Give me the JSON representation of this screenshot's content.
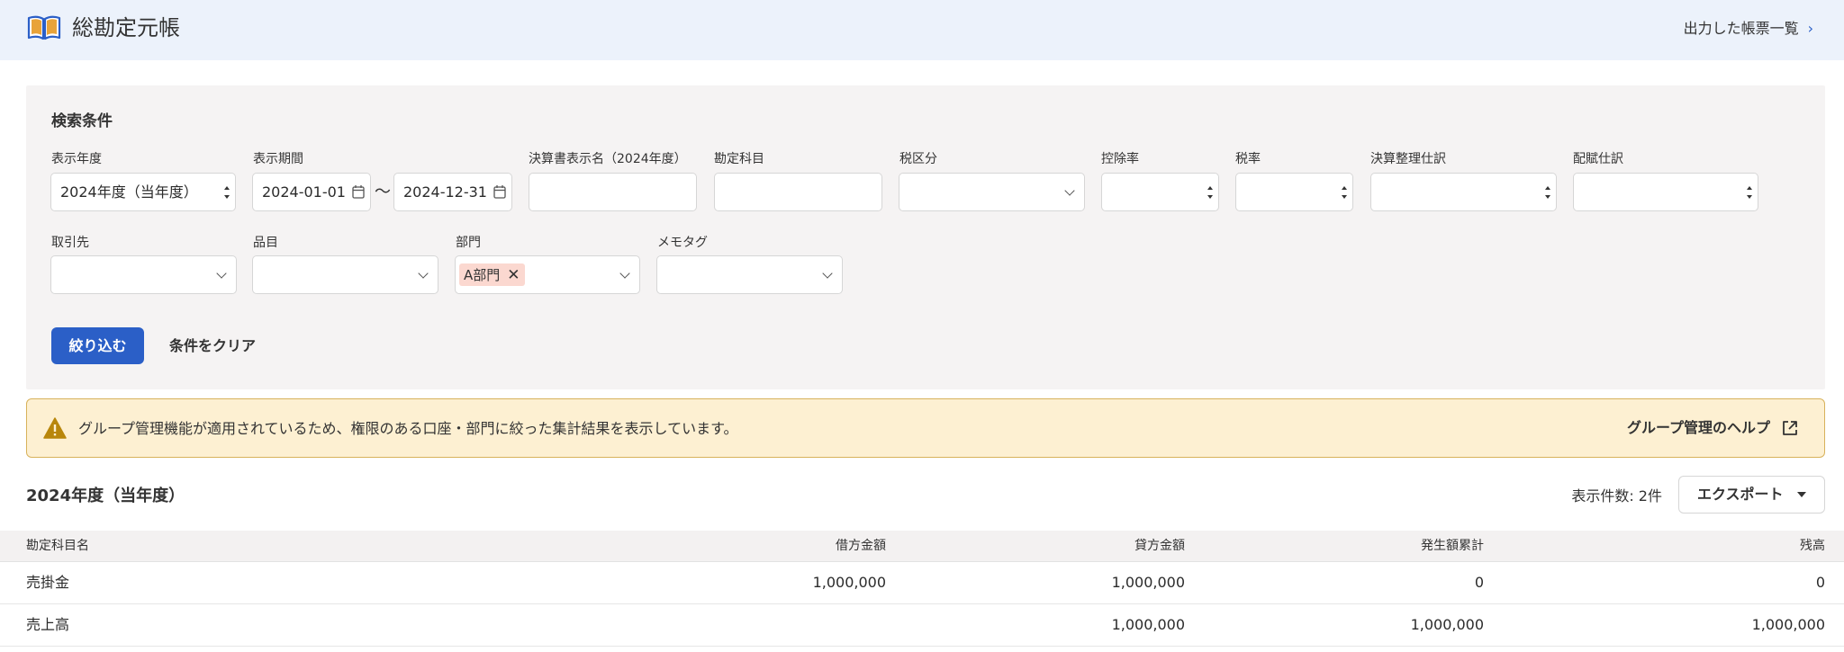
{
  "header": {
    "title": "総勘定元帳",
    "output_link": "出力した帳票一覧",
    "chevron": "›"
  },
  "search": {
    "title": "検索条件",
    "fiscal_year": {
      "label": "表示年度",
      "value": "2024年度（当年度）"
    },
    "period": {
      "label": "表示期間",
      "from": "2024-01-01",
      "separator": "〜",
      "to": "2024-12-31"
    },
    "statement_name": {
      "label": "決算書表示名（2024年度）",
      "value": ""
    },
    "account": {
      "label": "勘定科目",
      "value": ""
    },
    "tax_category": {
      "label": "税区分",
      "value": ""
    },
    "deduction_rate": {
      "label": "控除率",
      "value": ""
    },
    "tax_rate": {
      "label": "税率",
      "value": ""
    },
    "closing_entry": {
      "label": "決算整理仕訳",
      "value": ""
    },
    "allocation_entry": {
      "label": "配賦仕訳",
      "value": ""
    },
    "partner": {
      "label": "取引先",
      "value": ""
    },
    "item": {
      "label": "品目",
      "value": ""
    },
    "department": {
      "label": "部門",
      "tag": "A部門",
      "tag_remove": "✕"
    },
    "memo_tag": {
      "label": "メモタグ",
      "value": ""
    },
    "filter_button": "絞り込む",
    "clear_button": "条件をクリア"
  },
  "alert": {
    "message": "グループ管理機能が適用されているため、権限のある口座・部門に絞った集計結果を表示しています。",
    "help_link": "グループ管理のヘルプ"
  },
  "results": {
    "title": "2024年度（当年度）",
    "count": "表示件数: 2件",
    "export_label": "エクスポート",
    "columns": [
      "勘定科目名",
      "借方金額",
      "貸方金額",
      "発生額累計",
      "残高"
    ],
    "rows": [
      [
        "売掛金",
        "1,000,000",
        "1,000,000",
        "0",
        "0"
      ],
      [
        "売上高",
        "",
        "1,000,000",
        "1,000,000",
        "1,000,000"
      ]
    ]
  },
  "colors": {
    "primary": "#2b5fc7",
    "header_bg": "#ecf2fb",
    "panel_bg": "#f5f3f3",
    "alert_bg": "#fdf0d2",
    "tag_bg": "#fbd8d0",
    "book_icon": "#e8a33a"
  },
  "icons": {
    "header": "open-book-icon",
    "output_link": "chevron-right-icon",
    "period": "calendar-icon",
    "alert": "warning-triangle-icon",
    "help": "external-link-icon",
    "export": "caret-down-icon",
    "tag_remove": "close-icon"
  }
}
